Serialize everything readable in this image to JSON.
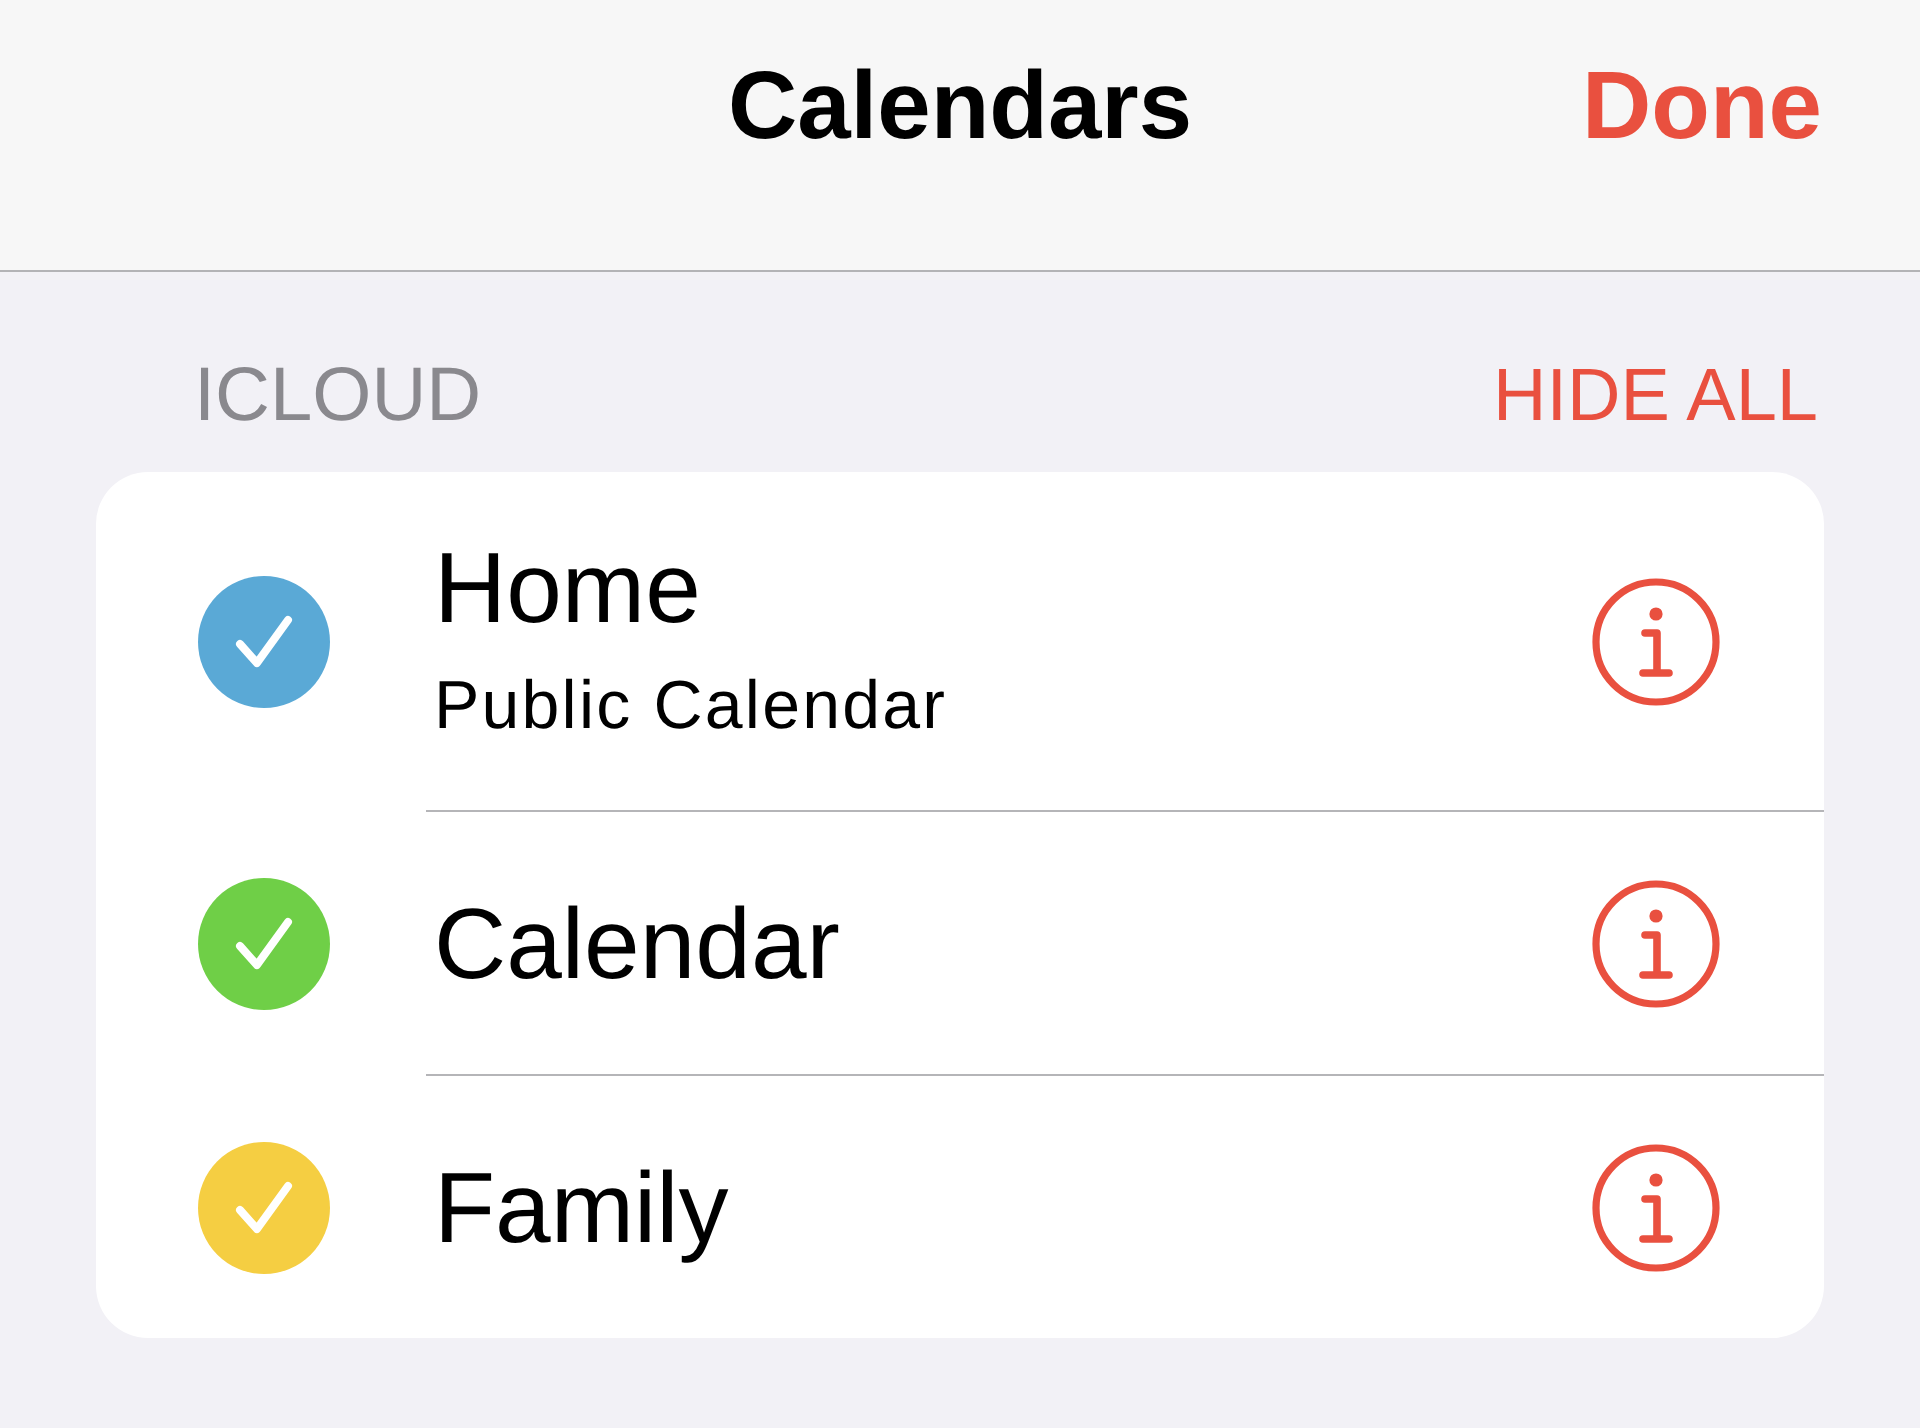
{
  "nav_bar": {
    "title": "Calendars",
    "done_button": "Done"
  },
  "section": {
    "header": "ICLOUD",
    "action": "HIDE ALL"
  },
  "calendars": [
    {
      "name": "Home",
      "subtitle": "Public Calendar",
      "color": "#5aa9d6",
      "checked": true
    },
    {
      "name": "Calendar",
      "color": "#6fcf47",
      "checked": true
    },
    {
      "name": "Family",
      "color": "#f5ce42",
      "checked": true
    }
  ]
}
